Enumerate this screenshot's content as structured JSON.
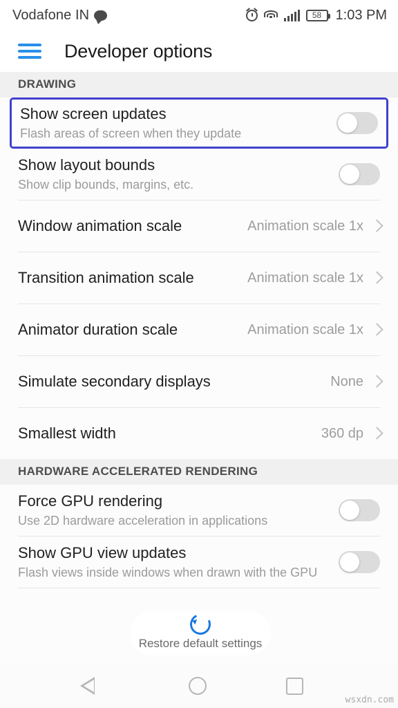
{
  "status_bar": {
    "carrier": "Vodafone IN",
    "chat_icon": "chat-bubble-icon",
    "alarm_icon": "alarm-icon",
    "wifi_icon": "wifi-icon",
    "signal_icon": "signal-bars-icon",
    "battery_level": "58",
    "time": "1:03 PM"
  },
  "action_bar": {
    "menu_icon": "hamburger-menu-icon",
    "title": "Developer options",
    "menu_color": "#2a8fea"
  },
  "sections": [
    {
      "header": "DRAWING",
      "rows": [
        {
          "title": "Show screen updates",
          "summary": "Flash areas of screen when they update",
          "control": "toggle",
          "checked": false,
          "highlighted": true,
          "highlight_color": "#4040cc"
        },
        {
          "title": "Show layout bounds",
          "summary": "Show clip bounds, margins, etc.",
          "control": "toggle",
          "checked": false,
          "highlighted": false
        },
        {
          "title": "Window animation scale",
          "summary": "",
          "control": "value",
          "value": "Animation scale 1x",
          "highlighted": false
        },
        {
          "title": "Transition animation scale",
          "summary": "",
          "control": "value",
          "value": "Animation scale 1x",
          "highlighted": false
        },
        {
          "title": "Animator duration scale",
          "summary": "",
          "control": "value",
          "value": "Animation scale 1x",
          "highlighted": false
        },
        {
          "title": "Simulate secondary displays",
          "summary": "",
          "control": "value",
          "value": "None",
          "highlighted": false
        },
        {
          "title": "Smallest width",
          "summary": "",
          "control": "value",
          "value": "360 dp",
          "highlighted": false
        }
      ]
    },
    {
      "header": "HARDWARE ACCELERATED RENDERING",
      "rows": [
        {
          "title": "Force GPU rendering",
          "summary": "Use 2D hardware acceleration in applications",
          "control": "toggle",
          "checked": false,
          "highlighted": false
        },
        {
          "title": "Show GPU view updates",
          "summary": "Flash views inside windows when drawn with the GPU",
          "control": "toggle",
          "checked": false,
          "highlighted": false
        }
      ]
    }
  ],
  "toast": {
    "label": "Restore default settings",
    "spinner_icon": "loading-spinner-icon",
    "spinner_color": "#1878e0"
  },
  "nav_bar": {
    "back": "back-triangle-icon",
    "home": "home-circle-icon",
    "recents": "recents-square-icon"
  },
  "watermark": "wsxdn.com"
}
